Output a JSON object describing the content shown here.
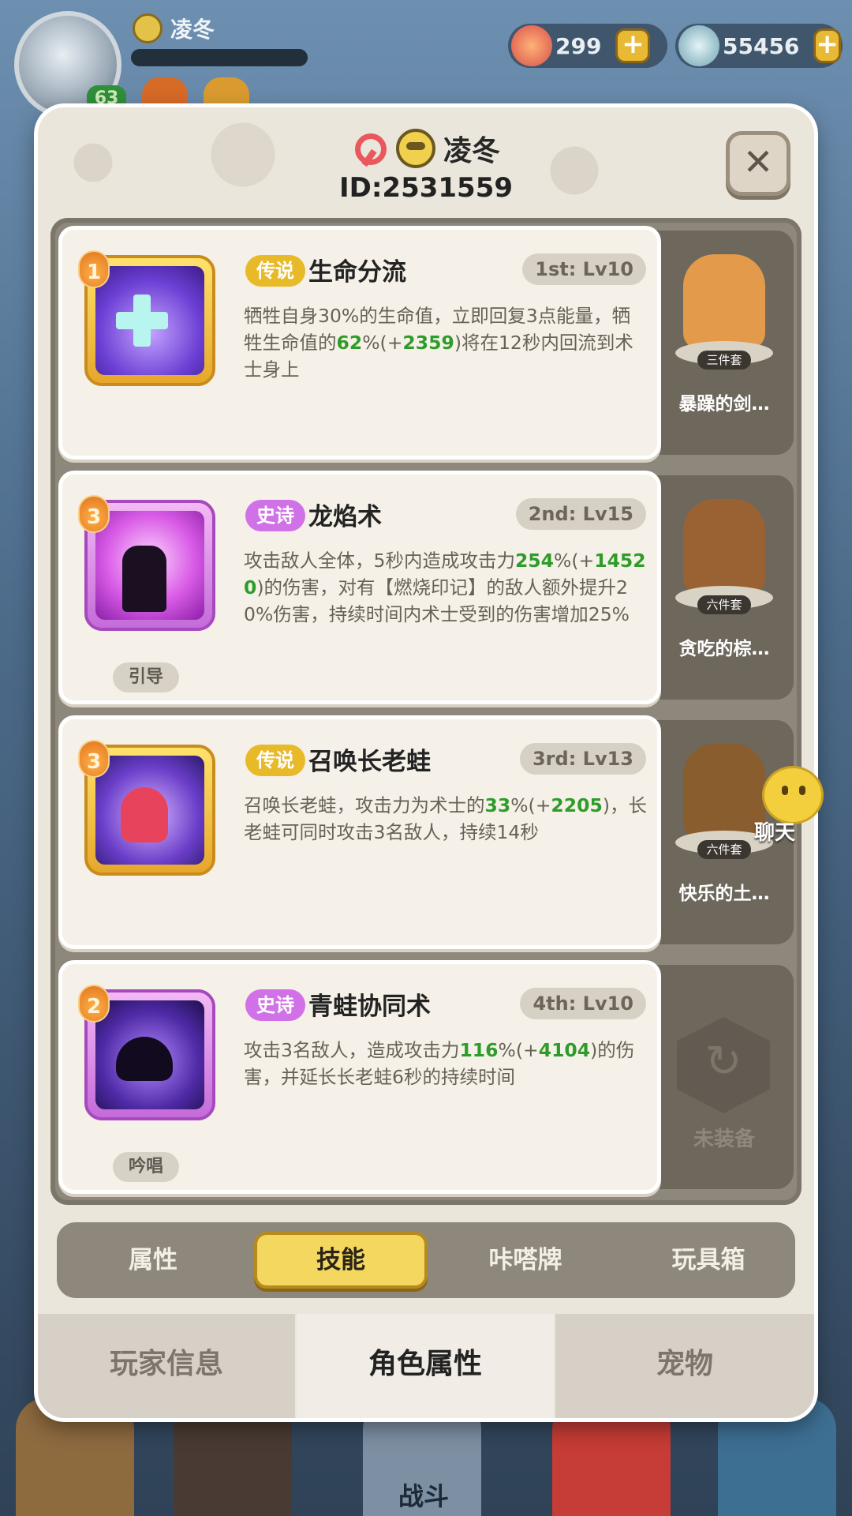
{
  "hud": {
    "player_name": "凌冬",
    "avatar_level": "63",
    "shell_count": "299",
    "pearl_count": "55456",
    "plus_label": "+",
    "battle_label": "战斗"
  },
  "dialog": {
    "player_name": "凌冬",
    "player_id": "ID:2531559",
    "close_label": "✕"
  },
  "skills": [
    {
      "level_badge": "1",
      "rarity": "传说",
      "name": "生命分流",
      "slot": "1st: Lv10",
      "desc_parts": [
        "牺牲自身30%的生命值，立即回复3点能量，牺牲生命值的",
        "62",
        "%(+",
        "2359",
        ")将在12秒内回流到术士身上"
      ],
      "tag": "",
      "pet_name": "暴躁的剑…",
      "pet_set": "三件套"
    },
    {
      "level_badge": "3",
      "rarity": "史诗",
      "name": "龙焰术",
      "slot": "2nd: Lv15",
      "desc_parts": [
        "攻击敌人全体，5秒内造成攻击力",
        "254",
        "%(+",
        "14520",
        ")的伤害，对有【燃烧印记】的敌人额外提升20%伤害，持续时间内术士受到的伤害增加25%"
      ],
      "tag": "引导",
      "pet_name": "贪吃的棕…",
      "pet_set": "六件套"
    },
    {
      "level_badge": "3",
      "rarity": "传说",
      "name": "召唤长老蛙",
      "slot": "3rd: Lv13",
      "desc_parts": [
        "召唤长老蛙，攻击力为术士的",
        "33",
        "%(+",
        "2205",
        ")，长老蛙可同时攻击3名敌人，持续14秒"
      ],
      "tag": "",
      "pet_name": "快乐的土…",
      "pet_set": "六件套"
    },
    {
      "level_badge": "2",
      "rarity": "史诗",
      "name": "青蛙协同术",
      "slot": "4th: Lv10",
      "desc_parts": [
        "攻击3名敌人，造成攻击力",
        "116",
        "%(+",
        "4104",
        ")的伤害，并延长长老蛙6秒的持续时间"
      ],
      "tag": "吟唱",
      "pet_name": "未装备",
      "pet_set": ""
    }
  ],
  "chat": {
    "label": "聊天"
  },
  "tabs": [
    "属性",
    "技能",
    "咔嗒牌",
    "玩具箱"
  ],
  "bottom_tabs": [
    "玩家信息",
    "角色属性",
    "宠物"
  ],
  "colors": {
    "gold_rarity": "#e8b928",
    "purple_rarity": "#d071e8",
    "highlight_green": "#2f9c2a",
    "active_tab": "#f4d75f"
  }
}
